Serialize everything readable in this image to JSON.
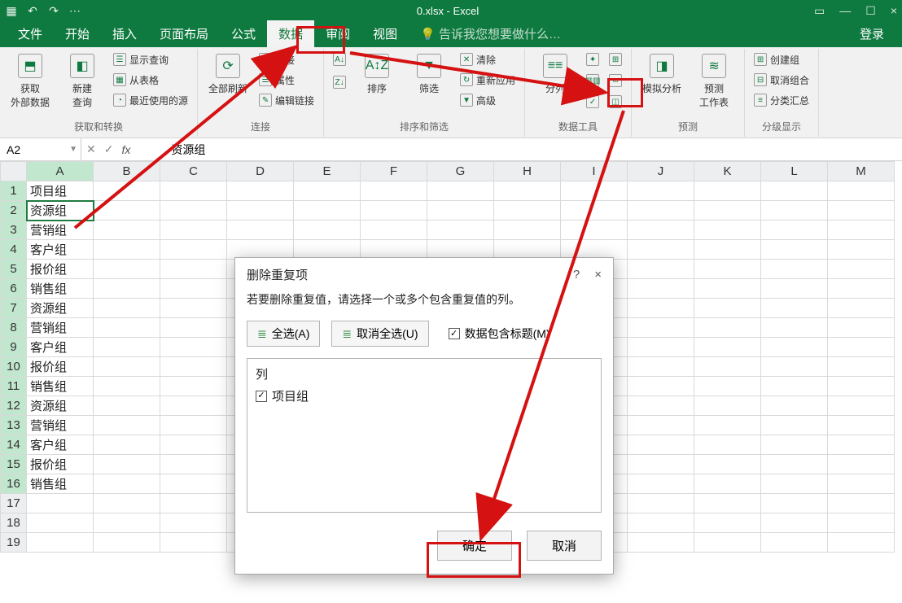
{
  "titlebar": {
    "doc": "0.xlsx - Excel"
  },
  "menubar": {
    "tabs": [
      "文件",
      "开始",
      "插入",
      "页面布局",
      "公式",
      "数据",
      "审阅",
      "视图"
    ],
    "activeIndex": 5,
    "tell_me": "告诉我您想要做什么…",
    "login": "登录"
  },
  "ribbon": {
    "groups": [
      {
        "label": "获取和转换",
        "items": [
          {
            "big": "获取\n外部数据",
            "icon": "⇩"
          },
          {
            "big": "新建\n查询",
            "icon": "◧"
          },
          {
            "list": [
              "显示查询",
              "从表格",
              "最近使用的源"
            ]
          }
        ]
      },
      {
        "label": "连接",
        "items": [
          {
            "big": "全部刷新",
            "icon": "⟳"
          },
          {
            "list": [
              "连接",
              "属性",
              "编辑链接"
            ]
          }
        ]
      },
      {
        "label": "排序和筛选",
        "items": [
          {
            "sortAZ": "A↓Z"
          },
          {
            "big": "排序",
            "icon": "A↕Z"
          },
          {
            "big": "筛选",
            "icon": "▼"
          },
          {
            "list": [
              "清除",
              "重新应用",
              "高级"
            ]
          }
        ]
      },
      {
        "label": "数据工具",
        "items": [
          {
            "big": "分列",
            "icon": "≡≡"
          }
        ]
      },
      {
        "label": "预测",
        "items": [
          {
            "big": "模拟分析",
            "icon": "◨"
          },
          {
            "big": "预测\n工作表",
            "icon": "⤧"
          }
        ]
      },
      {
        "label": "分级显示",
        "items": [
          {
            "list": [
              "创建组",
              "取消组合",
              "分类汇总"
            ]
          }
        ]
      }
    ]
  },
  "namebox": "A2",
  "formula": "资源组",
  "columns": [
    "A",
    "B",
    "C",
    "D",
    "E",
    "F",
    "G",
    "H",
    "I",
    "J",
    "K",
    "L",
    "M"
  ],
  "rows": [
    {
      "n": 1,
      "A": "项目组"
    },
    {
      "n": 2,
      "A": "资源组"
    },
    {
      "n": 3,
      "A": "营销组"
    },
    {
      "n": 4,
      "A": "客户组"
    },
    {
      "n": 5,
      "A": "报价组"
    },
    {
      "n": 6,
      "A": "销售组"
    },
    {
      "n": 7,
      "A": "资源组"
    },
    {
      "n": 8,
      "A": "营销组"
    },
    {
      "n": 9,
      "A": "客户组"
    },
    {
      "n": 10,
      "A": "报价组"
    },
    {
      "n": 11,
      "A": "销售组"
    },
    {
      "n": 12,
      "A": "资源组"
    },
    {
      "n": 13,
      "A": "营销组"
    },
    {
      "n": 14,
      "A": "客户组"
    },
    {
      "n": 15,
      "A": "报价组"
    },
    {
      "n": 16,
      "A": "销售组"
    },
    {
      "n": 17,
      "A": ""
    },
    {
      "n": 18,
      "A": ""
    },
    {
      "n": 19,
      "A": ""
    }
  ],
  "dialog": {
    "title": "删除重复项",
    "help": "?",
    "close": "×",
    "instr": "若要删除重复值，请选择一个或多个包含重复值的列。",
    "btn_selectall": "全选(A)",
    "btn_unselectall": "取消全选(U)",
    "chk_header": "数据包含标题(M)",
    "list_header": "列",
    "list_items": [
      {
        "checked": true,
        "label": "项目组"
      }
    ],
    "ok": "确定",
    "cancel": "取消"
  }
}
